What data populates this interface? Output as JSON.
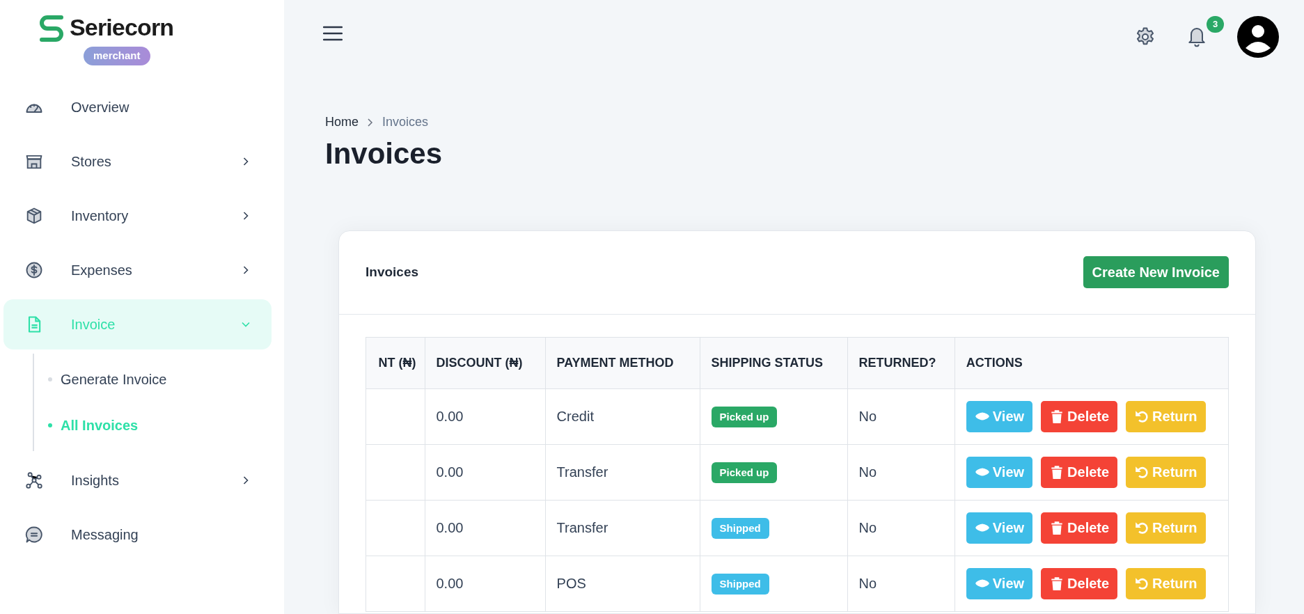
{
  "brand": {
    "name": "Seriecorn",
    "badge": "merchant"
  },
  "sidebar": {
    "items": [
      {
        "label": "Overview",
        "kind": "link",
        "selected": false
      },
      {
        "label": "Stores",
        "kind": "collapsed",
        "selected": false
      },
      {
        "label": "Inventory",
        "kind": "collapsed",
        "selected": false
      },
      {
        "label": "Expenses",
        "kind": "collapsed",
        "selected": false
      },
      {
        "label": "Invoice",
        "kind": "expanded",
        "selected": true,
        "children": [
          {
            "label": "Generate Invoice",
            "selected": false
          },
          {
            "label": "All Invoices",
            "selected": true
          }
        ]
      },
      {
        "label": "Insights",
        "kind": "collapsed",
        "selected": false
      },
      {
        "label": "Messaging",
        "kind": "link",
        "selected": false
      }
    ]
  },
  "topbar": {
    "notification_count": "3"
  },
  "breadcrumb": [
    "Home",
    "Invoices"
  ],
  "page_title": "Invoices",
  "card": {
    "title": "Invoices",
    "primary_button": "Create New Invoice",
    "table": {
      "columns": [
        "NT (₦)",
        "DISCOUNT (₦)",
        "PAYMENT METHOD",
        "SHIPPING STATUS",
        "RETURNED?",
        "ACTIONS"
      ],
      "rows": [
        {
          "discount": "0.00",
          "payment_method": "Credit",
          "shipping_status": {
            "label": "Picked up",
            "kind": "picked_up"
          },
          "returned": "No",
          "actions": [
            {
              "label": "View",
              "kind": "view"
            },
            {
              "label": "Delete",
              "kind": "delete"
            },
            {
              "label": "Return",
              "kind": "return"
            }
          ]
        },
        {
          "discount": "0.00",
          "payment_method": "Transfer",
          "shipping_status": {
            "label": "Picked up",
            "kind": "picked_up"
          },
          "returned": "No",
          "actions": [
            {
              "label": "View",
              "kind": "view"
            },
            {
              "label": "Delete",
              "kind": "delete"
            },
            {
              "label": "Return",
              "kind": "return"
            }
          ]
        },
        {
          "discount": "0.00",
          "payment_method": "Transfer",
          "shipping_status": {
            "label": "Shipped",
            "kind": "shipped"
          },
          "returned": "No",
          "actions": [
            {
              "label": "View",
              "kind": "view"
            },
            {
              "label": "Delete",
              "kind": "delete"
            },
            {
              "label": "Return",
              "kind": "return"
            }
          ]
        },
        {
          "discount": "0.00",
          "payment_method": "POS",
          "shipping_status": {
            "label": "Shipped",
            "kind": "shipped"
          },
          "returned": "No",
          "actions": [
            {
              "label": "View",
              "kind": "view"
            },
            {
              "label": "Delete",
              "kind": "delete"
            },
            {
              "label": "Return",
              "kind": "return"
            }
          ]
        }
      ]
    }
  }
}
